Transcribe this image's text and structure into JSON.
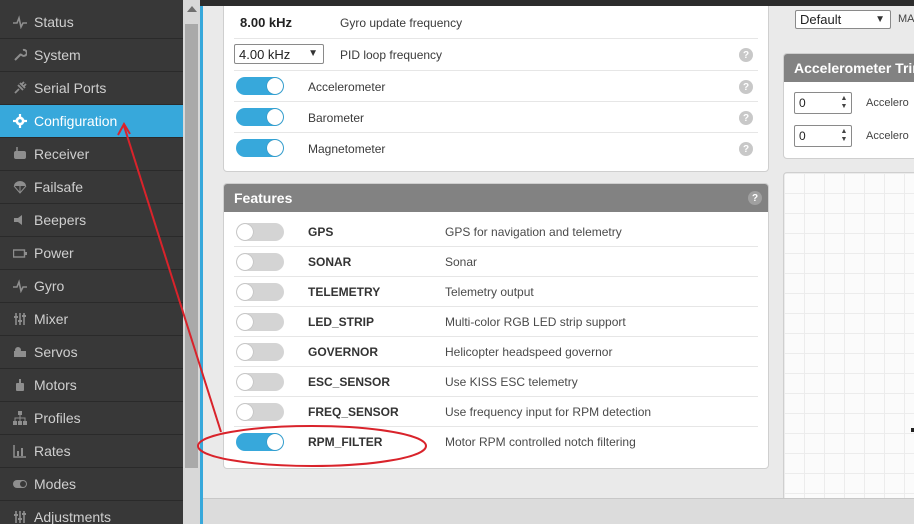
{
  "sidebar": {
    "items": [
      {
        "label": "Status",
        "icon": "pulse-icon"
      },
      {
        "label": "System",
        "icon": "wrench-icon"
      },
      {
        "label": "Serial Ports",
        "icon": "plug-icon"
      },
      {
        "label": "Configuration",
        "icon": "gear-icon",
        "active": true
      },
      {
        "label": "Receiver",
        "icon": "receiver-icon"
      },
      {
        "label": "Failsafe",
        "icon": "parachute-icon"
      },
      {
        "label": "Beepers",
        "icon": "beeper-icon"
      },
      {
        "label": "Power",
        "icon": "battery-icon"
      },
      {
        "label": "Gyro",
        "icon": "pulse-icon"
      },
      {
        "label": "Mixer",
        "icon": "sliders-icon"
      },
      {
        "label": "Servos",
        "icon": "servo-icon"
      },
      {
        "label": "Motors",
        "icon": "motor-icon"
      },
      {
        "label": "Profiles",
        "icon": "sitemap-icon"
      },
      {
        "label": "Rates",
        "icon": "chart-icon"
      },
      {
        "label": "Modes",
        "icon": "toggle-icon"
      },
      {
        "label": "Adjustments",
        "icon": "sliders-icon"
      }
    ]
  },
  "system": {
    "gyro_value": "8.00 kHz",
    "gyro_label": "Gyro update frequency",
    "pid_value": "4.00 kHz",
    "pid_label": "PID loop frequency",
    "sensors": [
      {
        "label": "Accelerometer",
        "on": true
      },
      {
        "label": "Barometer",
        "on": true
      },
      {
        "label": "Magnetometer",
        "on": true
      }
    ]
  },
  "features": {
    "title": "Features",
    "items": [
      {
        "name": "GPS",
        "desc": "GPS for navigation and telemetry",
        "on": false
      },
      {
        "name": "SONAR",
        "desc": "Sonar",
        "on": false
      },
      {
        "name": "TELEMETRY",
        "desc": "Telemetry output",
        "on": false
      },
      {
        "name": "LED_STRIP",
        "desc": "Multi-color RGB LED strip support",
        "on": false
      },
      {
        "name": "GOVERNOR",
        "desc": "Helicopter headspeed governor",
        "on": false
      },
      {
        "name": "ESC_SENSOR",
        "desc": "Use KISS ESC telemetry",
        "on": false
      },
      {
        "name": "FREQ_SENSOR",
        "desc": "Use frequency input for RPM detection",
        "on": false
      },
      {
        "name": "RPM_FILTER",
        "desc": "Motor RPM controlled notch filtering",
        "on": true
      }
    ]
  },
  "right": {
    "default_value": "Default",
    "default_suffix": "MA",
    "acc_trim_title": "Accelerometer Trim",
    "trim_rows": [
      {
        "value": "0",
        "label": "Accelero"
      },
      {
        "value": "0",
        "label": "Accelero"
      }
    ]
  },
  "colors": {
    "accent": "#37a8db",
    "annotation": "#d9232b"
  }
}
